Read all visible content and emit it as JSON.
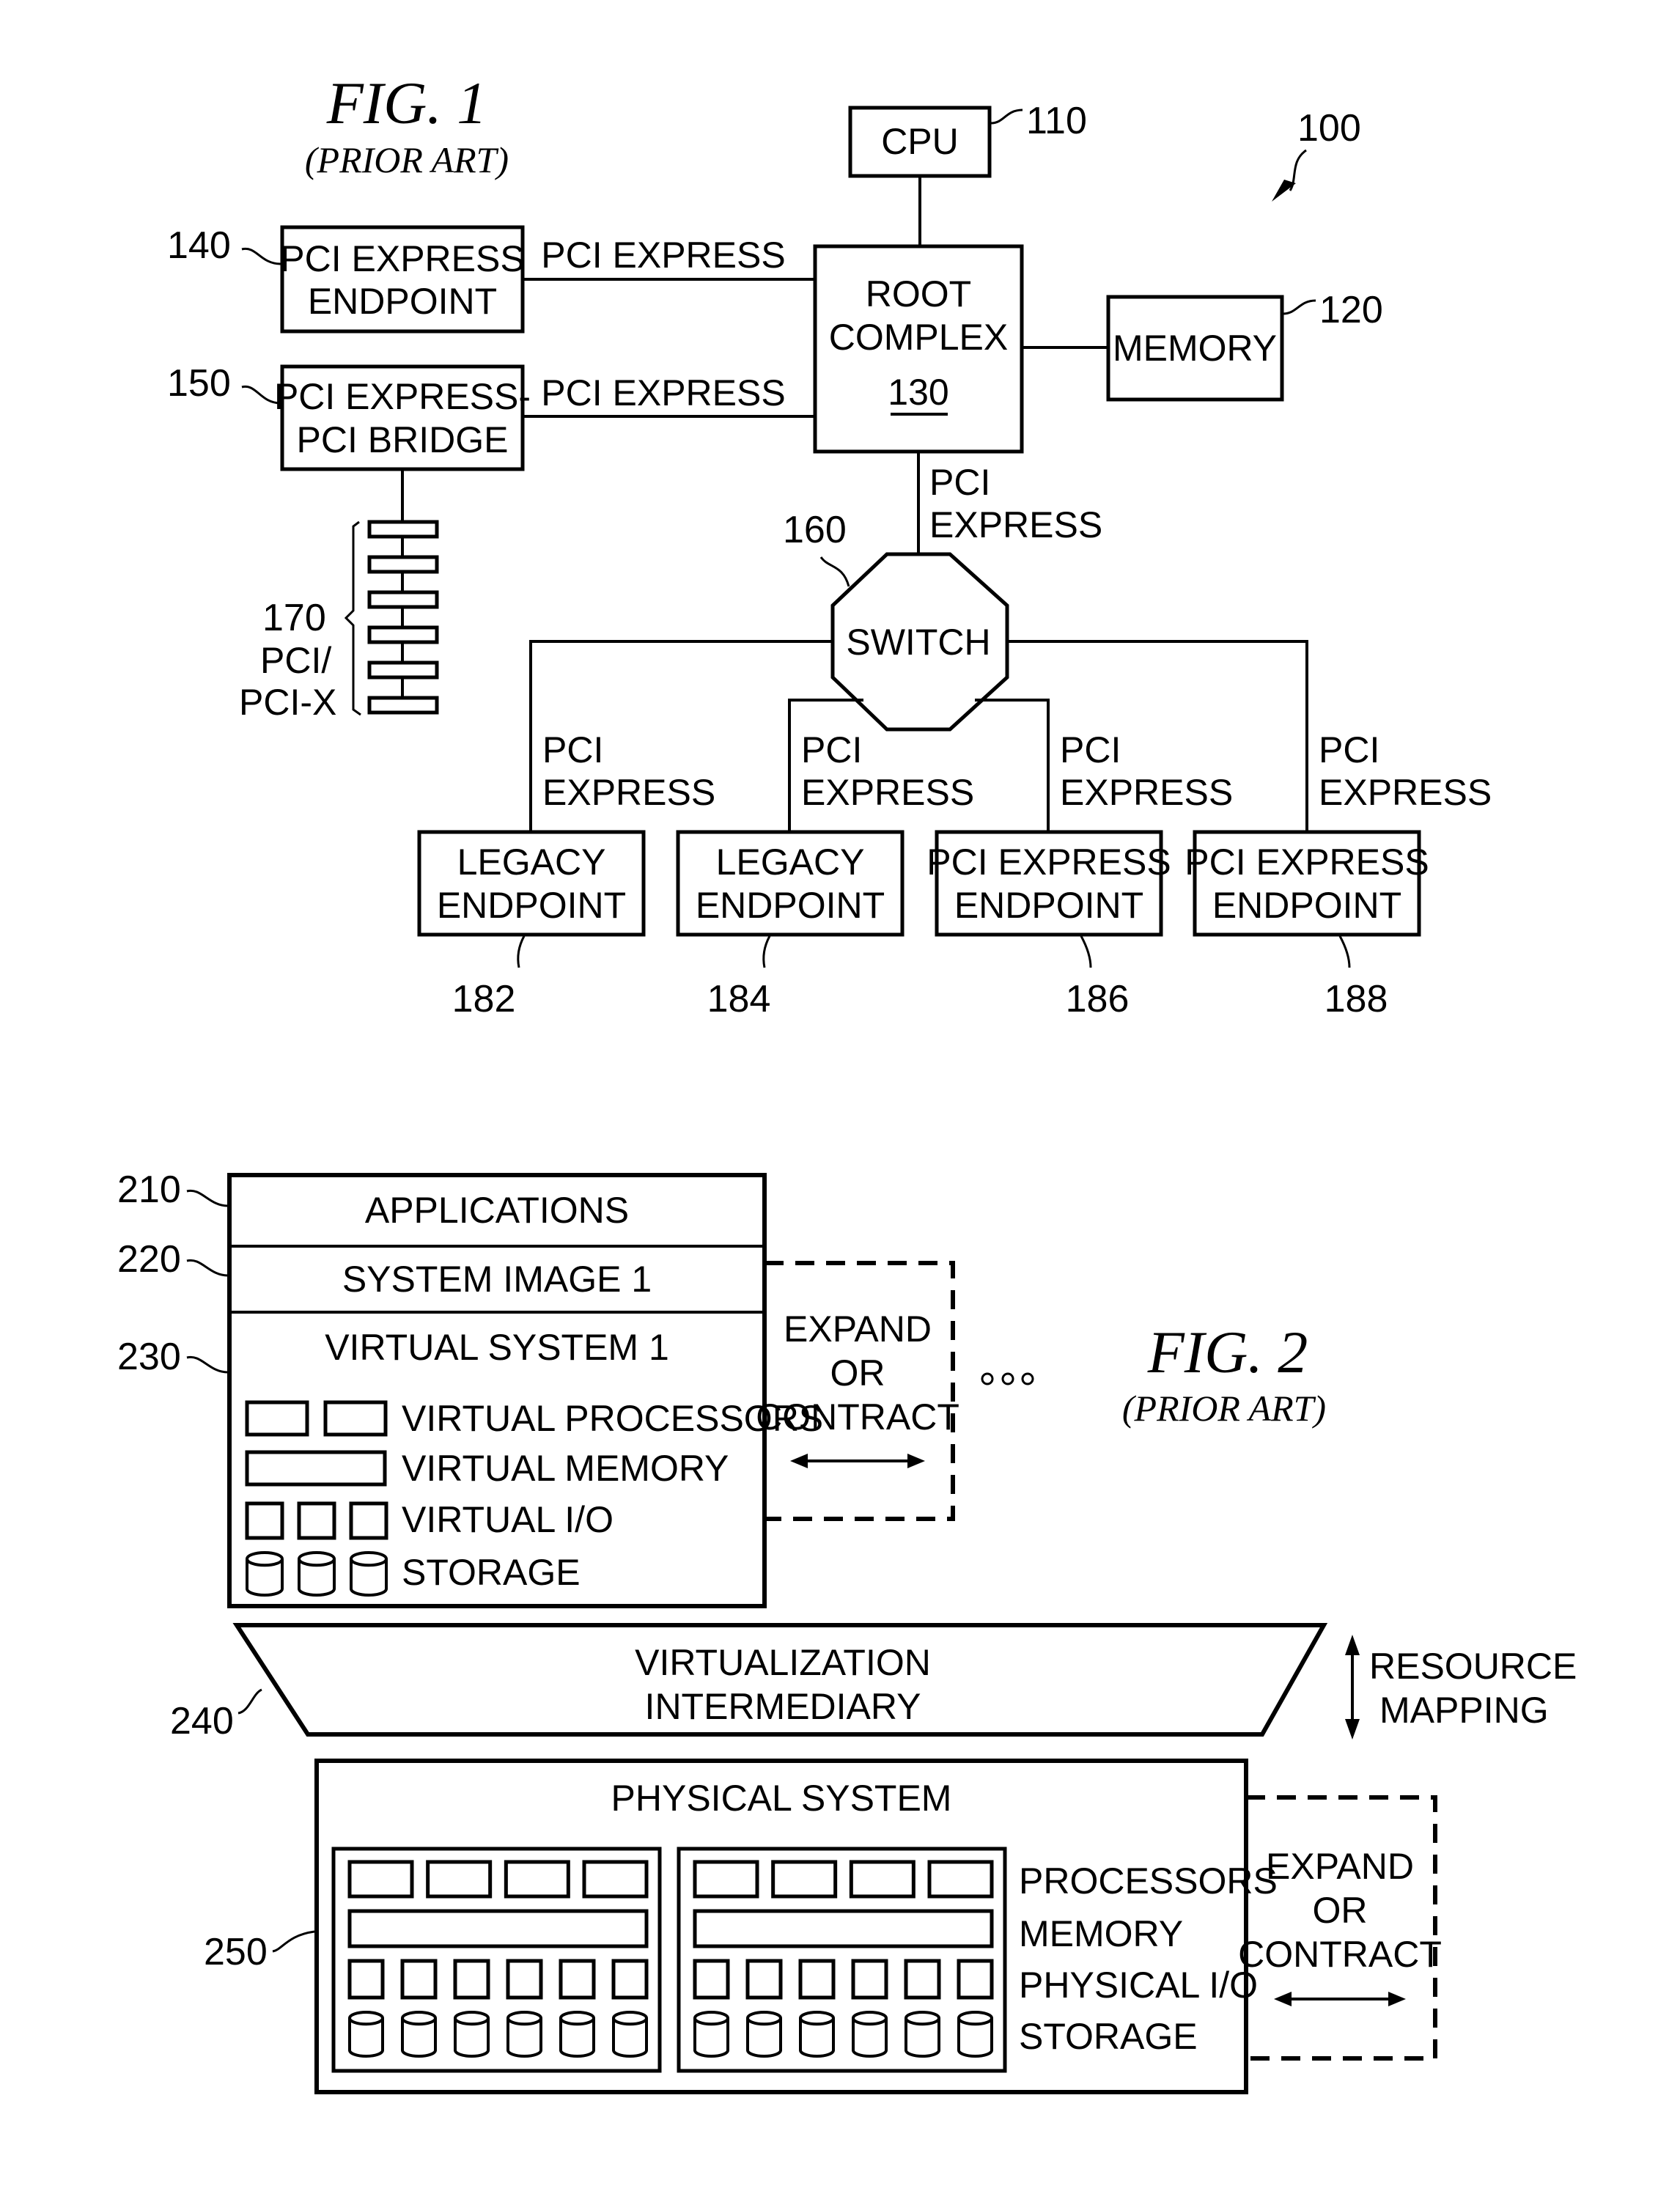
{
  "fig1": {
    "title": "FIG. 1",
    "subtitle": "(PRIOR ART)",
    "system_ref": "100",
    "cpu": {
      "label": "CPU",
      "ref": "110"
    },
    "memory": {
      "label": "MEMORY",
      "ref": "120"
    },
    "root_complex": {
      "line1": "ROOT",
      "line2": "COMPLEX",
      "ref": "130"
    },
    "endpoint_140": {
      "line1": "PCI EXPRESS",
      "line2": "ENDPOINT",
      "ref": "140",
      "link_label": "PCI EXPRESS"
    },
    "bridge_150": {
      "line1": "PCI EXPRESS-",
      "line2": "PCI BRIDGE",
      "ref": "150",
      "link_label": "PCI EXPRESS"
    },
    "root_to_switch_link": {
      "line1": "PCI",
      "line2": "EXPRESS"
    },
    "switch": {
      "label": "SWITCH",
      "ref": "160"
    },
    "pci_bus": {
      "ref": "170",
      "line1": "PCI/",
      "line2": "PCI-X",
      "slot_count": 6
    },
    "endpoints": [
      {
        "line1": "LEGACY",
        "line2": "ENDPOINT",
        "ref": "182",
        "link1": "PCI",
        "link2": "EXPRESS"
      },
      {
        "line1": "LEGACY",
        "line2": "ENDPOINT",
        "ref": "184",
        "link1": "PCI",
        "link2": "EXPRESS"
      },
      {
        "line1": "PCI EXPRESS",
        "line2": "ENDPOINT",
        "ref": "186",
        "link1": "PCI",
        "link2": "EXPRESS"
      },
      {
        "line1": "PCI EXPRESS",
        "line2": "ENDPOINT",
        "ref": "188",
        "link1": "PCI",
        "link2": "EXPRESS"
      }
    ]
  },
  "fig2": {
    "title": "FIG. 2",
    "subtitle": "(PRIOR ART)",
    "applications": {
      "label": "APPLICATIONS",
      "ref": "210"
    },
    "system_image": {
      "label": "SYSTEM IMAGE 1",
      "ref": "220"
    },
    "virtual_system": {
      "label": "VIRTUAL SYSTEM 1",
      "ref": "230",
      "rows": [
        {
          "label": "VIRTUAL PROCESSORS",
          "icon": "processor",
          "count": 2
        },
        {
          "label": "VIRTUAL MEMORY",
          "icon": "memory",
          "count": 1
        },
        {
          "label": "VIRTUAL I/O",
          "icon": "io",
          "count": 3
        },
        {
          "label": "STORAGE",
          "icon": "storage-cylinder",
          "count": 3
        }
      ]
    },
    "expand_virtual": {
      "line1": "EXPAND",
      "line2": "OR",
      "line3": "CONTRACT"
    },
    "ellipsis": "o o o",
    "intermediary": {
      "line1": "VIRTUALIZATION",
      "line2": "INTERMEDIARY",
      "ref": "240"
    },
    "resource_mapping": {
      "line1": "RESOURCE",
      "line2": "MAPPING"
    },
    "physical_system": {
      "label": "PHYSICAL SYSTEM",
      "ref": "250",
      "rows": [
        {
          "label": "PROCESSORS",
          "count_per_group": 4
        },
        {
          "label": "MEMORY",
          "count_per_group": 1
        },
        {
          "label": "PHYSICAL I/O",
          "count_per_group": 6
        },
        {
          "label": "STORAGE",
          "count_per_group": 6
        }
      ],
      "groups": 2
    },
    "expand_physical": {
      "line1": "EXPAND",
      "line2": "OR",
      "line3": "CONTRACT"
    }
  }
}
